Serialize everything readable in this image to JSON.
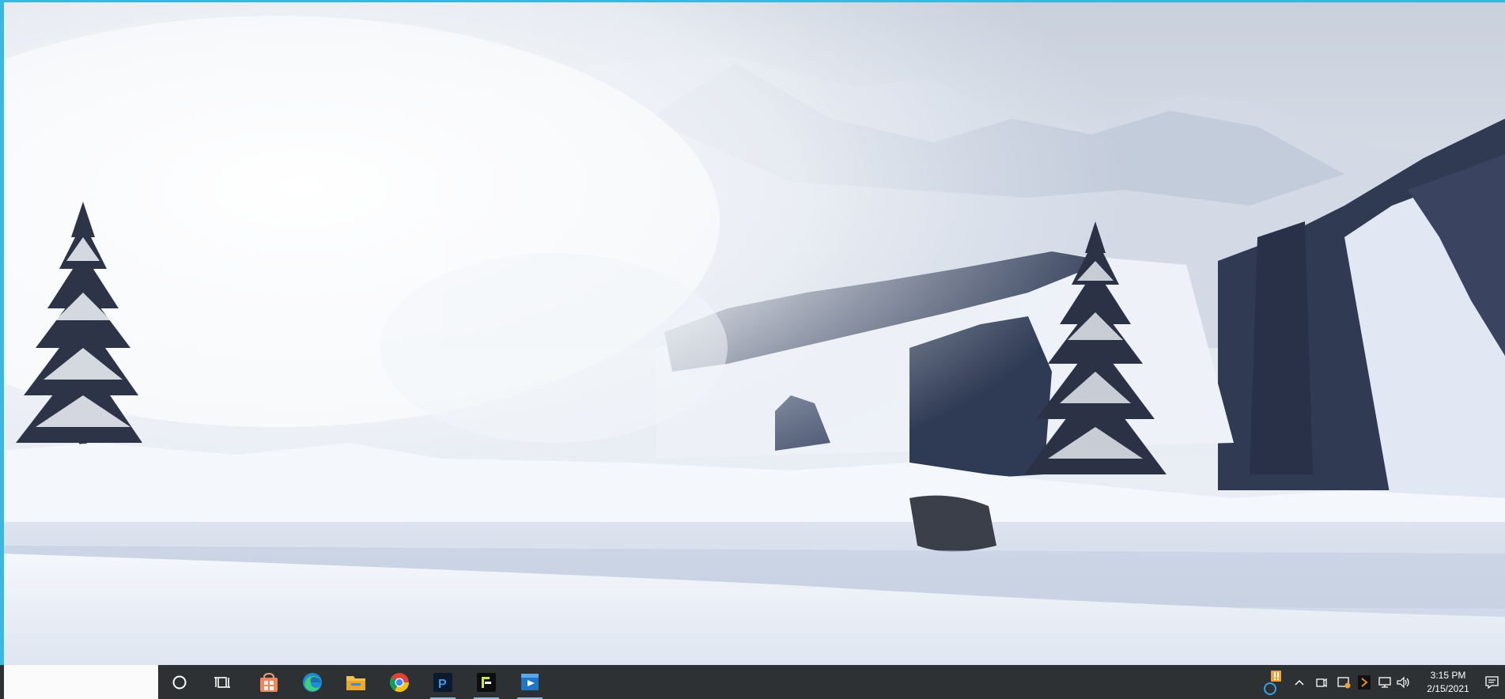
{
  "desktop": {
    "wallpaper": "snowy-mountain-landscape"
  },
  "taskbar": {
    "search_box_value": "",
    "pinned_apps": [
      {
        "name": "cortana-icon",
        "running": false
      },
      {
        "name": "task-view-icon",
        "running": false
      },
      {
        "name": "microsoft-store-icon",
        "running": false
      },
      {
        "name": "edge-icon",
        "running": false
      },
      {
        "name": "file-explorer-icon",
        "running": false
      },
      {
        "name": "chrome-icon",
        "running": false
      },
      {
        "name": "app-p-icon",
        "running": false
      },
      {
        "name": "app-terminal-icon",
        "running": false
      },
      {
        "name": "video-player-icon",
        "running": false
      }
    ],
    "tray_icons": [
      "update-warning-icon",
      "show-hidden-icons-chevron",
      "meet-now-icon",
      "security-icon",
      "media-icon",
      "network-icon",
      "volume-icon"
    ],
    "clock": {
      "time": "3:15 PM",
      "date": "2/15/2021"
    },
    "notification_icon": "action-center-icon"
  },
  "colors": {
    "taskbar": "#2e3133",
    "search_box": "#fbfbfb",
    "window_frame": "#3ab8e0",
    "warning": "#f0a23a"
  }
}
